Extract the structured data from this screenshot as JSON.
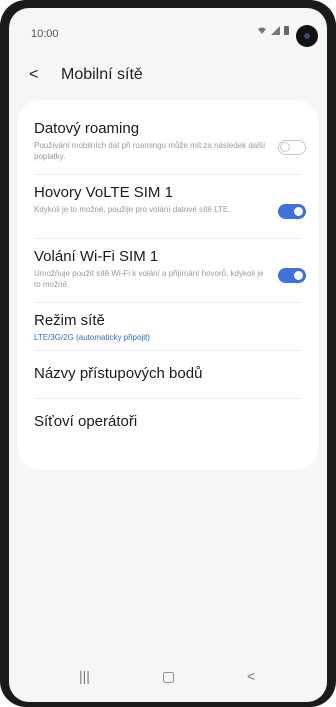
{
  "status_bar": {
    "time": "10:00",
    "icons": [
      "wifi-icon",
      "signal-icon",
      "battery-icon"
    ]
  },
  "app_bar": {
    "back_glyph": "<",
    "title": "Mobilní sítě"
  },
  "settings": [
    {
      "title": "Datový roaming",
      "description": "Používání mobilních dat při roamingu může mít za následek další poplatky.",
      "toggle": "off"
    },
    {
      "title": "Hovory VoLTE SIM 1",
      "description": "Kdykoli je to možné, použije pro volání datové sítě LTE.",
      "toggle": "on"
    },
    {
      "title": "Volání Wi-Fi SIM 1",
      "description": "Umožňuje použít sítě Wi-Fi k volání a přijímání hovorů, kdykoli je to možné.",
      "toggle": "on"
    },
    {
      "title": "Režim sítě",
      "value": "LTE/3G/2G (automaticky připojit)"
    },
    {
      "title": "Názvy přístupových bodů"
    },
    {
      "title": "Síťoví operátoři"
    }
  ],
  "nav_bar": {
    "recents_glyph": "|||",
    "home_glyph": "▢",
    "back_glyph": "<"
  },
  "colors": {
    "accent": "#3e72d8",
    "value_text": "#2f6fd1",
    "background": "#f6f6f6"
  }
}
